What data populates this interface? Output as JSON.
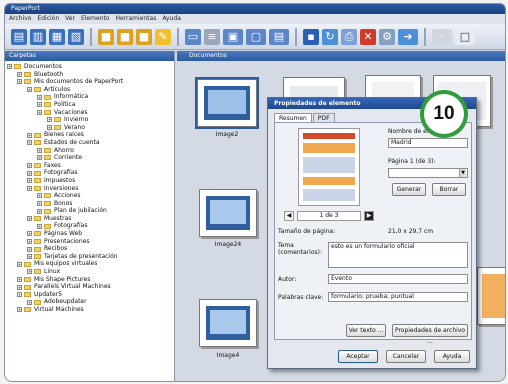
{
  "window": {
    "title": "PaperPort"
  },
  "menu": [
    "Archivo",
    "Edición",
    "Ver",
    "Elemento",
    "Herramientas",
    "Ayuda"
  ],
  "left_panel": {
    "title": "Carpetas",
    "tree": [
      {
        "label": "Documentos",
        "indent": 0
      },
      {
        "label": "Bluetooth",
        "indent": 1
      },
      {
        "label": "Mis documentos de PaperPort",
        "indent": 1
      },
      {
        "label": "Artículos",
        "indent": 2
      },
      {
        "label": "Informática",
        "indent": 3
      },
      {
        "label": "Política",
        "indent": 3
      },
      {
        "label": "Vacaciones",
        "indent": 3
      },
      {
        "label": "Invierno",
        "indent": 4
      },
      {
        "label": "Verano",
        "indent": 4
      },
      {
        "label": "Bienes raíces",
        "indent": 2
      },
      {
        "label": "Estados de cuenta",
        "indent": 2
      },
      {
        "label": "Ahorro",
        "indent": 3
      },
      {
        "label": "Corriente",
        "indent": 3
      },
      {
        "label": "Faxes",
        "indent": 2
      },
      {
        "label": "Fotografías",
        "indent": 2
      },
      {
        "label": "Impuestos",
        "indent": 2
      },
      {
        "label": "Inversiones",
        "indent": 2
      },
      {
        "label": "Acciones",
        "indent": 3
      },
      {
        "label": "Bonos",
        "indent": 3
      },
      {
        "label": "Plan de jubilación",
        "indent": 3
      },
      {
        "label": "Muestras",
        "indent": 2
      },
      {
        "label": "Fotografías",
        "indent": 3
      },
      {
        "label": "Páginas Web",
        "indent": 2
      },
      {
        "label": "Presentaciones",
        "indent": 2
      },
      {
        "label": "Recibos",
        "indent": 2
      },
      {
        "label": "Tarjetas de presentación",
        "indent": 2
      },
      {
        "label": "Mis equipos virtuales",
        "indent": 1
      },
      {
        "label": "Linux",
        "indent": 2
      },
      {
        "label": "Mis Shape Pictures",
        "indent": 1
      },
      {
        "label": "Parallels Virtual Machines",
        "indent": 1
      },
      {
        "label": "Updater5",
        "indent": 1
      },
      {
        "label": "Adobeupdater",
        "indent": 2
      },
      {
        "label": "Virtual Machines",
        "indent": 1
      }
    ]
  },
  "right_panel": {
    "title": "Documentos",
    "thumbs": [
      {
        "label": "Image2"
      },
      {
        "label": "Image24"
      },
      {
        "label": "Image4"
      }
    ]
  },
  "dialog": {
    "title": "Propiedades de elemento",
    "tabs": [
      "Resumen",
      "PDF"
    ],
    "page_nav": "1 de 3",
    "nombre_label": "Nombre de elemento:",
    "nombre_value": "Madrid",
    "pagina_label": "Página 1 (de 3):",
    "generar": "Generar",
    "borrar": "Borrar",
    "tamano_label": "Tamaño de página:",
    "tamano_value": "21,0 x 29,7 cm",
    "tema_label": "Tema (comentarios):",
    "tema_value": "esto es un formulario oficial",
    "autor_label": "Autor:",
    "autor_value": "Evento",
    "palabras_label": "Palabras clave:",
    "palabras_value": "formulario; prueba; puntual",
    "ver_texto": "Ver texto ...",
    "propiedades_archivo": "Propiedades de archivo ...",
    "aceptar": "Aceptar",
    "cancelar": "Cancelar",
    "ayuda": "Ayuda"
  },
  "badge": {
    "number": "10"
  },
  "colors": {
    "accent": "#2c5aa0",
    "badge": "#2e9d3a"
  }
}
